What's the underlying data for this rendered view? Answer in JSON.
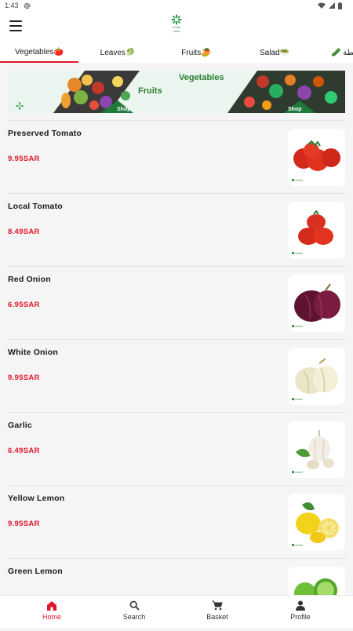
{
  "status_bar": {
    "time": "1:43"
  },
  "app": {
    "logo_text_1": "Fruits",
    "logo_text_2": "Land"
  },
  "tabs": [
    {
      "label": "Vegetables🍅",
      "active": true
    },
    {
      "label": "Leaves🥬",
      "active": false
    },
    {
      "label": "Fruits🥭",
      "active": false
    },
    {
      "label": "Salad🥗",
      "active": false
    },
    {
      "label": "🥒 سلطة",
      "active": false
    }
  ],
  "banner": {
    "title_vegetables": "Vegetables",
    "title_fruits": "Fruits",
    "shop_label": "Shop"
  },
  "products": [
    {
      "name": "Preserved Tomato",
      "price": "9.95SAR",
      "image": "tomato-cluster"
    },
    {
      "name": "Local Tomato",
      "price": "8.49SAR",
      "image": "tomato-pile"
    },
    {
      "name": "Red Onion",
      "price": "6.95SAR",
      "image": "red-onion"
    },
    {
      "name": "White Onion",
      "price": "9.95SAR",
      "image": "white-onion"
    },
    {
      "name": "Garlic",
      "price": "6.49SAR",
      "image": "garlic"
    },
    {
      "name": "Yellow Lemon",
      "price": "9.95SAR",
      "image": "yellow-lemon"
    },
    {
      "name": "Green Lemon",
      "price": "",
      "image": "green-lemon"
    }
  ],
  "bottom_nav": [
    {
      "label": "Home",
      "icon": "home-icon",
      "active": true
    },
    {
      "label": "Search",
      "icon": "search-icon",
      "active": false
    },
    {
      "label": "Basket",
      "icon": "cart-icon",
      "active": false
    },
    {
      "label": "Profile",
      "icon": "person-icon",
      "active": false
    }
  ],
  "colors": {
    "accent": "#e0172c",
    "brand_green": "#2e7d32",
    "background": "#f5f5f5"
  }
}
